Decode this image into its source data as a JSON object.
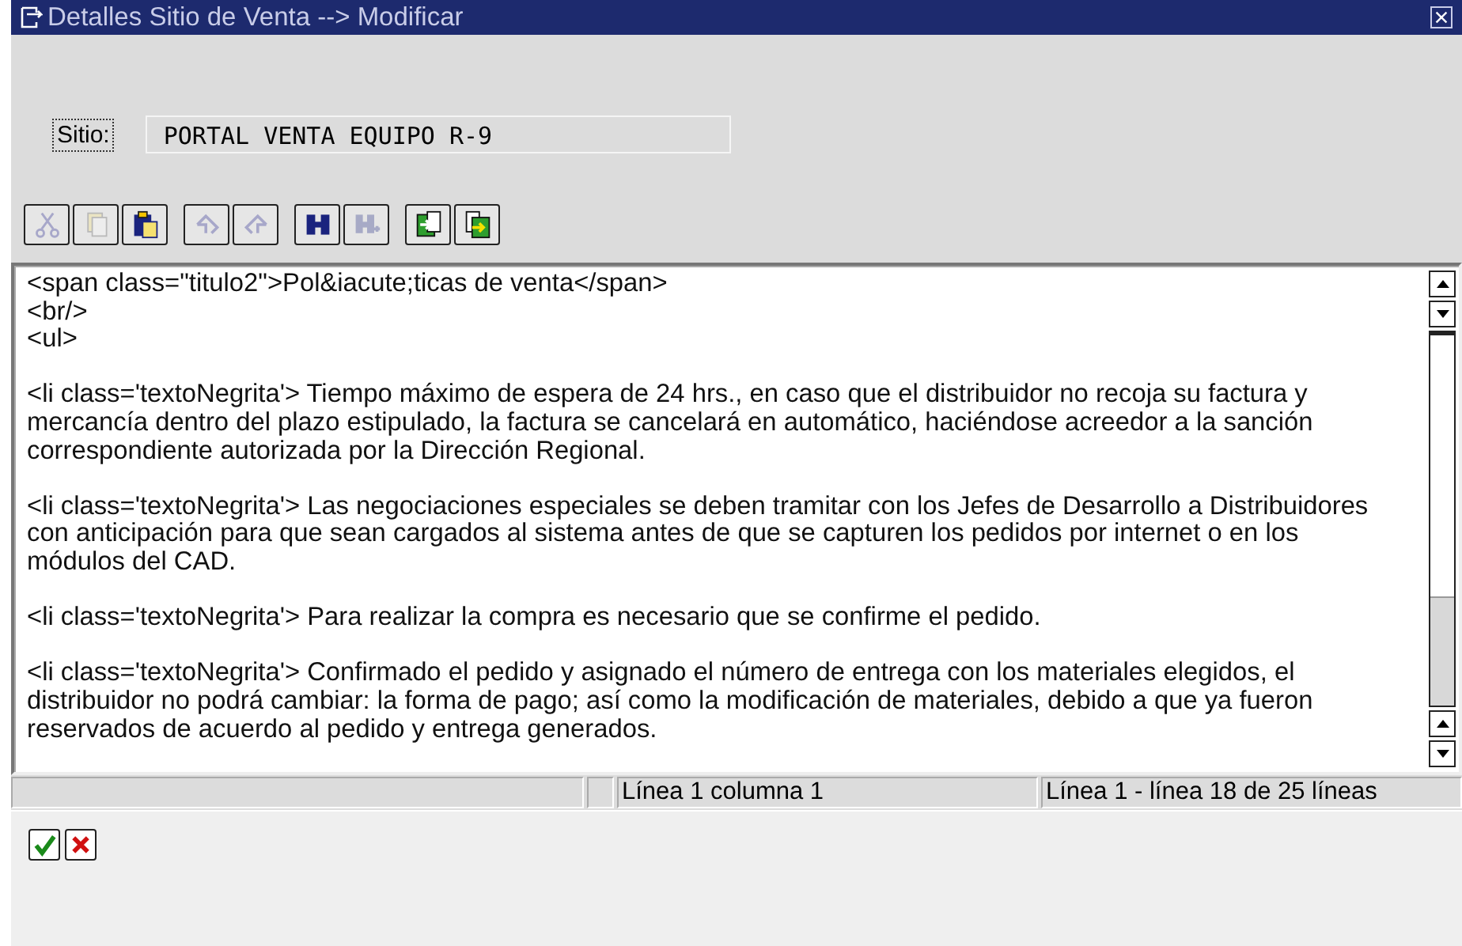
{
  "window": {
    "title": "Detalles Sitio de Venta --> Modificar"
  },
  "site": {
    "label": "Sitio:",
    "value": "PORTAL VENTA EQUIPO R-9"
  },
  "toolbar": [
    [
      {
        "kind": "cut",
        "disabled": true
      },
      {
        "kind": "copy",
        "disabled": true
      },
      {
        "kind": "paste",
        "disabled": false
      }
    ],
    [
      {
        "kind": "undo",
        "disabled": true
      },
      {
        "kind": "redo",
        "disabled": true
      }
    ],
    [
      {
        "kind": "find",
        "disabled": false
      },
      {
        "kind": "find-next",
        "disabled": true
      }
    ],
    [
      {
        "kind": "import",
        "disabled": false
      },
      {
        "kind": "export",
        "disabled": false
      }
    ]
  ],
  "editor": {
    "paragraphs": [
      {
        "lines": [
          "<span class=\"titulo2\">Pol&iacute;ticas de venta</span>",
          "<br/>",
          "<ul>"
        ]
      },
      {
        "lines": [
          "<li class='textoNegrita'>  Tiempo máximo de espera de 24 hrs., en caso que el distribuidor no recoja su factura y",
          "mercancía dentro del plazo estipulado, la factura se cancelará en automático, haciéndose acreedor a la sanción",
          "correspondiente autorizada por la Dirección Regional."
        ]
      },
      {
        "lines": [
          "<li class='textoNegrita'> Las negociaciones especiales se deben tramitar con los Jefes de Desarrollo a Distribuidores",
          "con anticipación para que sean cargados al sistema antes de que se capturen los pedidos por internet o en los",
          "módulos del CAD."
        ]
      },
      {
        "lines": [
          "<li class='textoNegrita'> Para realizar la compra es necesario que se confirme el pedido."
        ]
      },
      {
        "lines": [
          "<li class='textoNegrita'> Confirmado el pedido y asignado el número de entrega con los materiales elegidos, el",
          "distribuidor no podrá cambiar: la forma de pago; así como la modificación de materiales, debido a que ya fueron",
          "reservados de acuerdo al pedido y entrega generados."
        ]
      }
    ]
  },
  "status_bar": {
    "position": "Línea 1 columna 1",
    "range": "Línea 1 - línea 18 de 25 líneas"
  },
  "actions": [
    {
      "kind": "confirm"
    },
    {
      "kind": "cancel"
    }
  ]
}
